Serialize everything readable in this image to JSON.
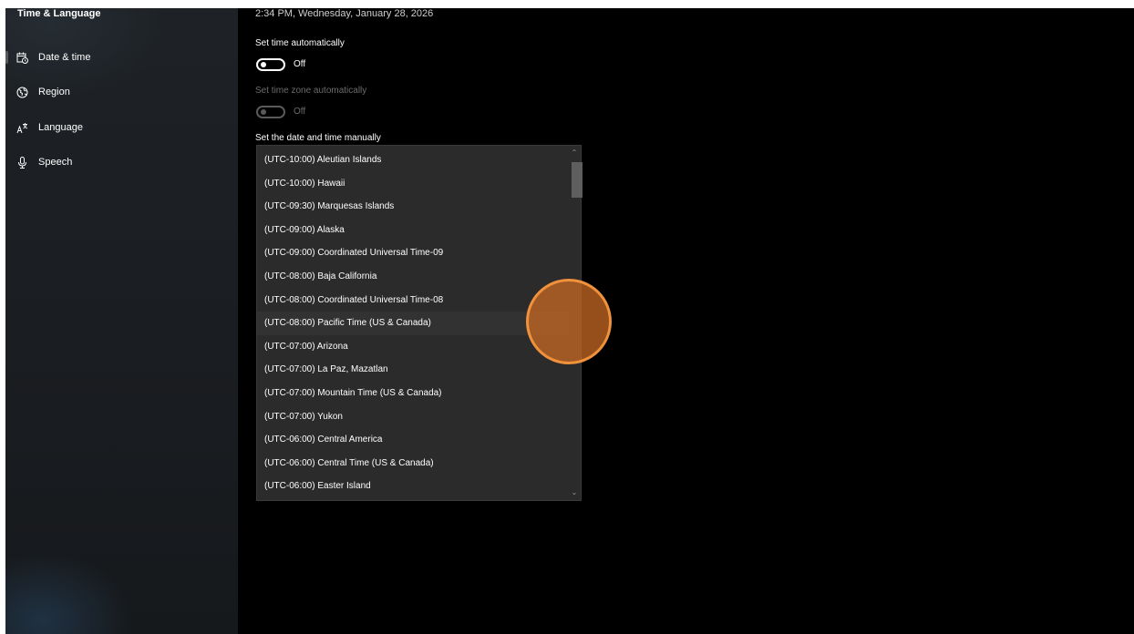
{
  "sidebar": {
    "title": "Time & Language",
    "items": [
      {
        "label": "Date & time",
        "icon": "calendar-clock-icon",
        "selected": true
      },
      {
        "label": "Region",
        "icon": "globe-icon",
        "selected": false
      },
      {
        "label": "Language",
        "icon": "language-icon",
        "selected": false
      },
      {
        "label": "Speech",
        "icon": "microphone-icon",
        "selected": false
      }
    ]
  },
  "main": {
    "current_date_time": "2:34 PM, Wednesday, January 28, 2026",
    "set_time_auto": {
      "label": "Set time automatically",
      "state": "Off"
    },
    "set_timezone_auto": {
      "label": "Set time zone automatically",
      "state": "Off"
    },
    "manual_label": "Set the date and time manually"
  },
  "timezone_dropdown": {
    "options": [
      "(UTC-10:00) Aleutian Islands",
      "(UTC-10:00) Hawaii",
      "(UTC-09:30) Marquesas Islands",
      "(UTC-09:00) Alaska",
      "(UTC-09:00) Coordinated Universal Time-09",
      "(UTC-08:00) Baja California",
      "(UTC-08:00) Coordinated Universal Time-08",
      "(UTC-08:00) Pacific Time (US & Canada)",
      "(UTC-07:00) Arizona",
      "(UTC-07:00) La Paz, Mazatlan",
      "(UTC-07:00) Mountain Time (US & Canada)",
      "(UTC-07:00) Yukon",
      "(UTC-06:00) Central America",
      "(UTC-06:00) Central Time (US & Canada)",
      "(UTC-06:00) Easter Island"
    ],
    "hovered_index": 7,
    "scroll_up_glyph": "⌃",
    "scroll_down_glyph": "⌄"
  },
  "colors": {
    "background": "#000000",
    "sidebar": "#1c1f23",
    "dropdown": "#2b2b2b",
    "click_indicator": "#f0913c"
  }
}
